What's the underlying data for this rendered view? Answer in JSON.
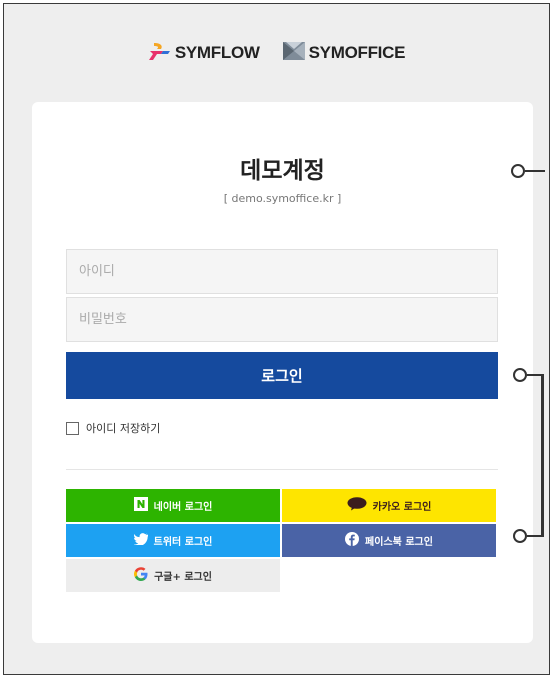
{
  "brands": {
    "symflow": "SYMFLOW",
    "symoffice": "SYMOFFICE"
  },
  "card": {
    "title": "데모계정",
    "subtitle": "[ demo.symoffice.kr ]"
  },
  "form": {
    "id_placeholder": "아이디",
    "password_placeholder": "비밀번호",
    "login_label": "로그인",
    "remember_label": "아이디 저장하기",
    "remember_checked": false
  },
  "social": {
    "naver": "네이버 로그인",
    "kakao": "카카오 로그인",
    "twitter": "트위터 로그인",
    "facebook": "페이스북 로그인",
    "google": "구글+ 로그인"
  },
  "colors": {
    "login": "#154a9e",
    "naver": "#2db400",
    "kakao": "#fee500",
    "twitter": "#1da1f2",
    "facebook": "#4a63a6",
    "google": "#ededed"
  },
  "icons": {
    "symflow": "symflow-logo-icon",
    "symoffice": "symoffice-logo-icon",
    "naver": "naver-n-icon",
    "kakao": "kakao-talk-icon",
    "twitter": "twitter-bird-icon",
    "facebook": "facebook-f-icon",
    "google": "google-g-icon"
  }
}
